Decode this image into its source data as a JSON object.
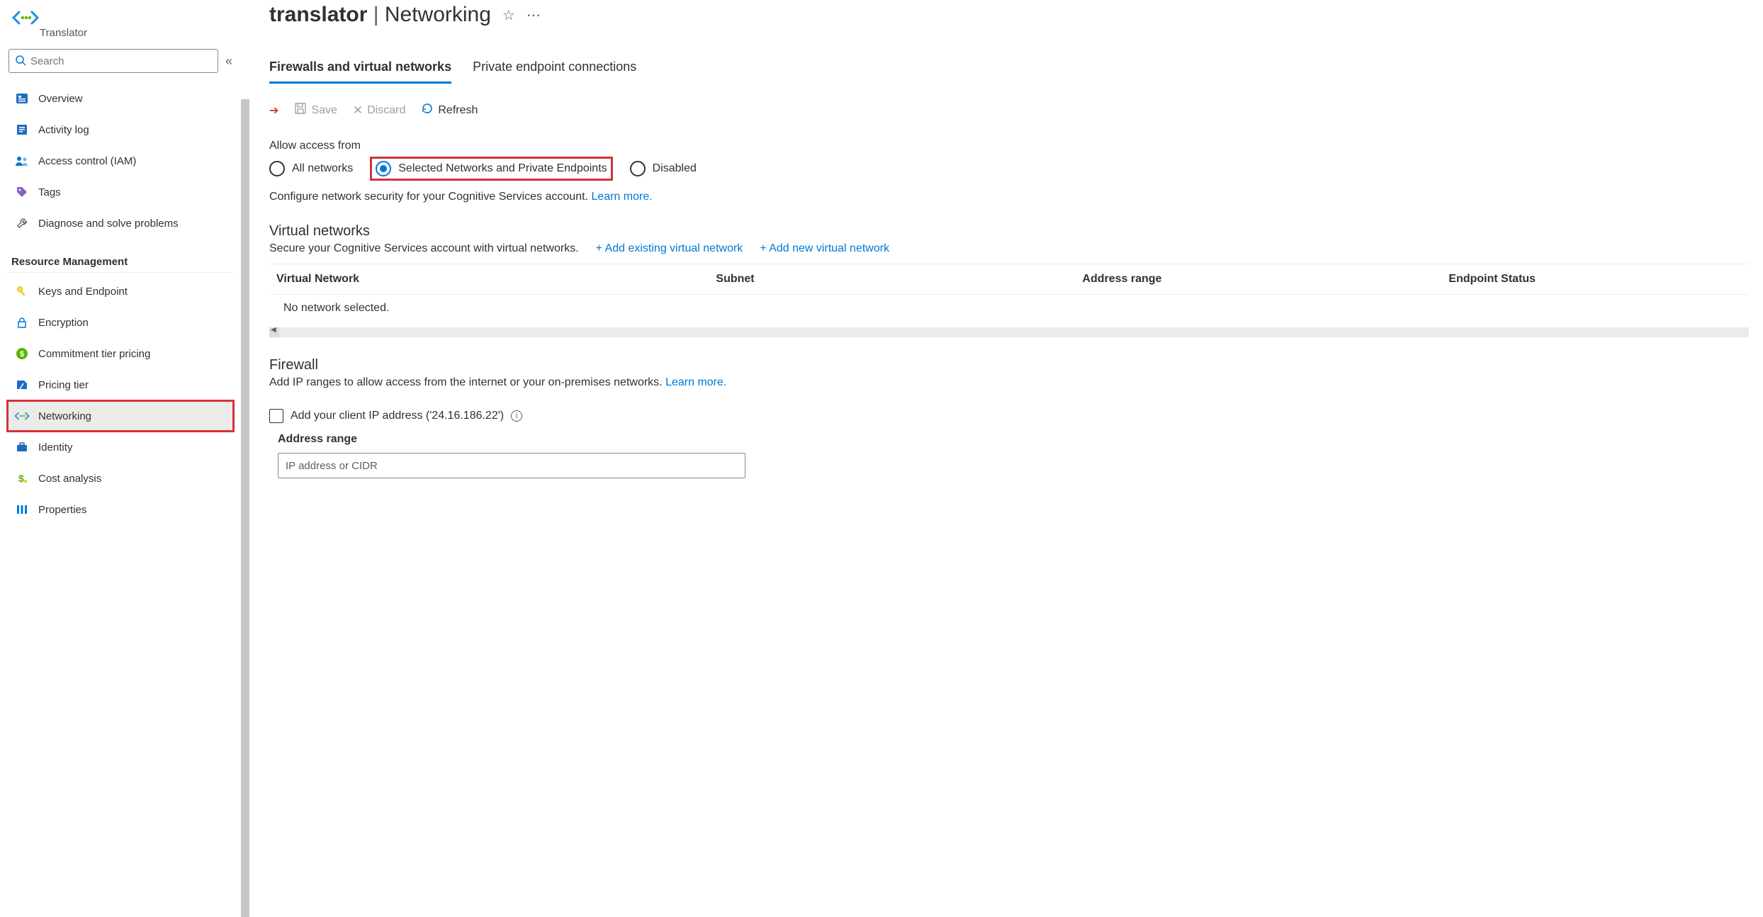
{
  "brand": {
    "label": "Translator"
  },
  "search": {
    "placeholder": "Search"
  },
  "sidebar": {
    "groups": [
      {
        "header": null,
        "items": [
          {
            "label": "Overview",
            "icon": "overview-icon"
          },
          {
            "label": "Activity log",
            "icon": "activity-log-icon"
          },
          {
            "label": "Access control (IAM)",
            "icon": "iam-icon"
          },
          {
            "label": "Tags",
            "icon": "tags-icon"
          },
          {
            "label": "Diagnose and solve problems",
            "icon": "wrench-icon"
          }
        ]
      },
      {
        "header": "Resource Management",
        "items": [
          {
            "label": "Keys and Endpoint",
            "icon": "key-icon"
          },
          {
            "label": "Encryption",
            "icon": "lock-icon"
          },
          {
            "label": "Commitment tier pricing",
            "icon": "dollar-circle-icon"
          },
          {
            "label": "Pricing tier",
            "icon": "pricing-icon"
          },
          {
            "label": "Networking",
            "icon": "translator-icon",
            "selected": true
          },
          {
            "label": "Identity",
            "icon": "briefcase-icon"
          },
          {
            "label": "Cost analysis",
            "icon": "cost-icon"
          },
          {
            "label": "Properties",
            "icon": "properties-icon"
          }
        ]
      }
    ]
  },
  "header": {
    "name": "translator",
    "section": "Networking"
  },
  "tabs": [
    {
      "label": "Firewalls and virtual networks",
      "active": true
    },
    {
      "label": "Private endpoint connections",
      "active": false
    }
  ],
  "toolbar": {
    "save": "Save",
    "discard": "Discard",
    "refresh": "Refresh"
  },
  "access": {
    "label": "Allow access from",
    "options": [
      {
        "label": "All networks"
      },
      {
        "label": "Selected Networks and Private Endpoints",
        "selected": true,
        "highlight": true
      },
      {
        "label": "Disabled"
      }
    ],
    "desc": "Configure network security for your Cognitive Services account.",
    "learn": "Learn more."
  },
  "vnet": {
    "heading": "Virtual networks",
    "desc": "Secure your Cognitive Services account with virtual networks.",
    "add_existing": "+ Add existing virtual network",
    "add_new": "+ Add new virtual network",
    "columns": [
      "Virtual Network",
      "Subnet",
      "Address range",
      "Endpoint Status"
    ],
    "empty": "No network selected."
  },
  "firewall": {
    "heading": "Firewall",
    "desc": "Add IP ranges to allow access from the internet or your on-premises networks.",
    "learn": "Learn more.",
    "checkbox_label": "Add your client IP address ('24.16.186.22')",
    "column_label": "Address range",
    "input_placeholder": "IP address or CIDR"
  }
}
